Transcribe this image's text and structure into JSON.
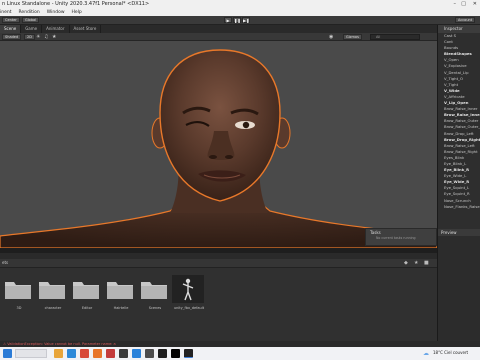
{
  "window": {
    "title": "n Linux Standalone - Unity 2020.3.47f1 Personal* <DX11>",
    "menu": [
      "inent",
      "Rendition",
      "Window",
      "Help"
    ]
  },
  "toolbar": {
    "left_buttons": [
      "Center",
      "Global"
    ],
    "play_icons": [
      "▶",
      "❚❚",
      "▶❚"
    ],
    "right_label": "Account"
  },
  "scene_tabs": [
    "Scene",
    "Game",
    "Animator",
    "Asset Store"
  ],
  "scene_bar": {
    "mode": "Shaded",
    "twoD": "2D",
    "gizmos": "Gizmos",
    "search": "All"
  },
  "tooltip": {
    "title": "Tasks",
    "body": "No current tasks running"
  },
  "inspector": {
    "tab": "Inspector",
    "rows": [
      {
        "label": "Cast S",
        "bold": false
      },
      {
        "label": "Cont",
        "bold": false
      },
      {
        "label": "Bounds",
        "bold": false
      },
      {
        "label": "",
        "bold": false
      },
      {
        "label": "BlendShapes",
        "bold": true
      },
      {
        "label": "V_Open",
        "bold": false
      },
      {
        "label": "V_Explosive",
        "bold": false
      },
      {
        "label": "V_Dental_Lip",
        "bold": false
      },
      {
        "label": "V_Tight_O",
        "bold": false
      },
      {
        "label": "V_Tight",
        "bold": false
      },
      {
        "label": "V_Wide",
        "bold": true
      },
      {
        "label": "V_Affricate",
        "bold": false
      },
      {
        "label": "V_Lip_Open",
        "bold": true
      },
      {
        "label": "Brow_Raise_Inner",
        "bold": false
      },
      {
        "label": "Brow_Raise_Inner_R",
        "bold": true
      },
      {
        "label": "Brow_Raise_Outer",
        "bold": false
      },
      {
        "label": "Brow_Raise_Outer_R",
        "bold": false
      },
      {
        "label": "Brow_Drop_Left",
        "bold": false
      },
      {
        "label": "Brow_Drop_Right",
        "bold": true
      },
      {
        "label": "Brow_Raise_Left",
        "bold": false
      },
      {
        "label": "Brow_Raise_Right",
        "bold": false
      },
      {
        "label": "Eyes_Blink",
        "bold": false
      },
      {
        "label": "Eye_Blink_L",
        "bold": false
      },
      {
        "label": "Eye_Blink_R",
        "bold": true
      },
      {
        "label": "Eye_Wide_L",
        "bold": false
      },
      {
        "label": "Eye_Wide_R",
        "bold": true
      },
      {
        "label": "Eye_Squint_L",
        "bold": false
      },
      {
        "label": "Eye_Squint_R",
        "bold": false
      },
      {
        "label": "Nose_Scrunch",
        "bold": false
      },
      {
        "label": "Nose_Flanks_Raise",
        "bold": false
      }
    ]
  },
  "preview": {
    "title": "Preview"
  },
  "project": {
    "breadcrumb": "ets",
    "assets": [
      {
        "name": "3D",
        "type": "folder"
      },
      {
        "name": "character",
        "type": "folder"
      },
      {
        "name": "Editor",
        "type": "folder"
      },
      {
        "name": "Hairtelle",
        "type": "folder"
      },
      {
        "name": "Scenes",
        "type": "folder"
      },
      {
        "name": "unity_fbx_default",
        "type": "model"
      }
    ]
  },
  "console_error": "ValidationException: Value cannot be null. Parameter name: a",
  "taskbar": {
    "weather": "18°C  Ciel couvert",
    "time": ""
  },
  "colors": {
    "selection_outline": "#e8782a",
    "error_text": "#d85a5a",
    "accent_blue": "#6aa7e8"
  }
}
